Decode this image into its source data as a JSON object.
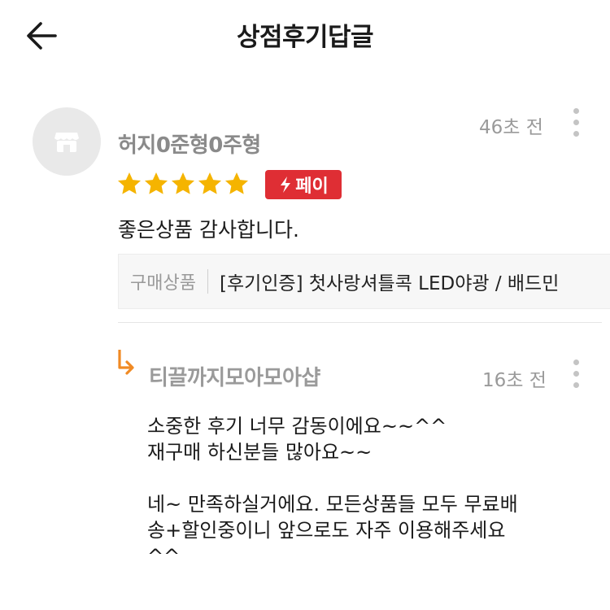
{
  "header": {
    "title": "상점후기답글"
  },
  "review": {
    "reviewer_name": "허지0준형0주형",
    "time": "46초 전",
    "rating": 5,
    "rating_max": 5,
    "pay_badge": "페이",
    "text": "좋은상품 감사합니다.",
    "product_label": "구매상품",
    "product_name": "[후기인증] 첫사랑셔틀콕 LED야광 / 배드민"
  },
  "reply": {
    "shop_name": "티끌까지모아모아샵",
    "time": "16초 전",
    "text": "소중한 후기 너무 감동이에요~~^^\n재구매 하신분들 많아요~~\n\n네~ 만족하실거에요. 모든상품들 모두 무료배\n송+할인중이니 앞으로도 자주 이용해주세요\n^^"
  },
  "colors": {
    "star": "#f5b400",
    "pay_badge": "#df2e34",
    "reply_arrow": "#f08a24"
  }
}
